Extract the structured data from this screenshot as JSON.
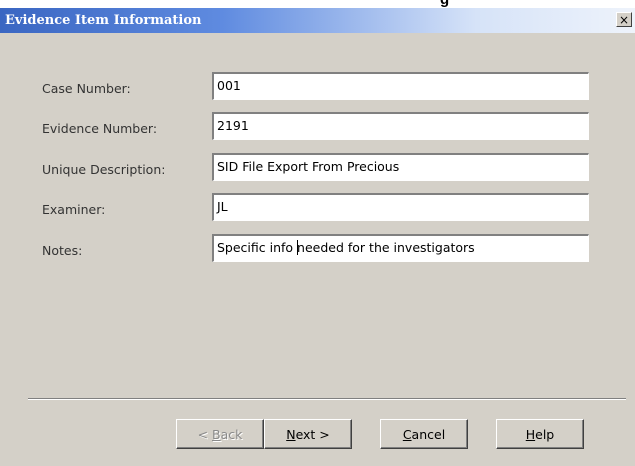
{
  "top_clip_text": "g",
  "dialog": {
    "title": "Evidence Item Information",
    "close_glyph": "×"
  },
  "form": {
    "case_number": {
      "label": "Case Number:",
      "value": "001"
    },
    "evidence_number": {
      "label": "Evidence Number:",
      "value": "2191"
    },
    "unique_description": {
      "label": "Unique Description:",
      "value": "SID File Export From Precious"
    },
    "examiner": {
      "label": "Examiner:",
      "value": "JL"
    },
    "notes": {
      "label": "Notes:",
      "value_before_caret": "Specific info ",
      "value_after_caret": "needed for the investigators"
    }
  },
  "buttons": {
    "back": {
      "prefix": "< ",
      "mnemonic": "B",
      "rest": "ack",
      "enabled": false
    },
    "next": {
      "mnemonic": "N",
      "rest": "ext >"
    },
    "cancel": {
      "mnemonic": "C",
      "rest": "ancel"
    },
    "help": {
      "mnemonic": "H",
      "rest": "elp"
    }
  }
}
